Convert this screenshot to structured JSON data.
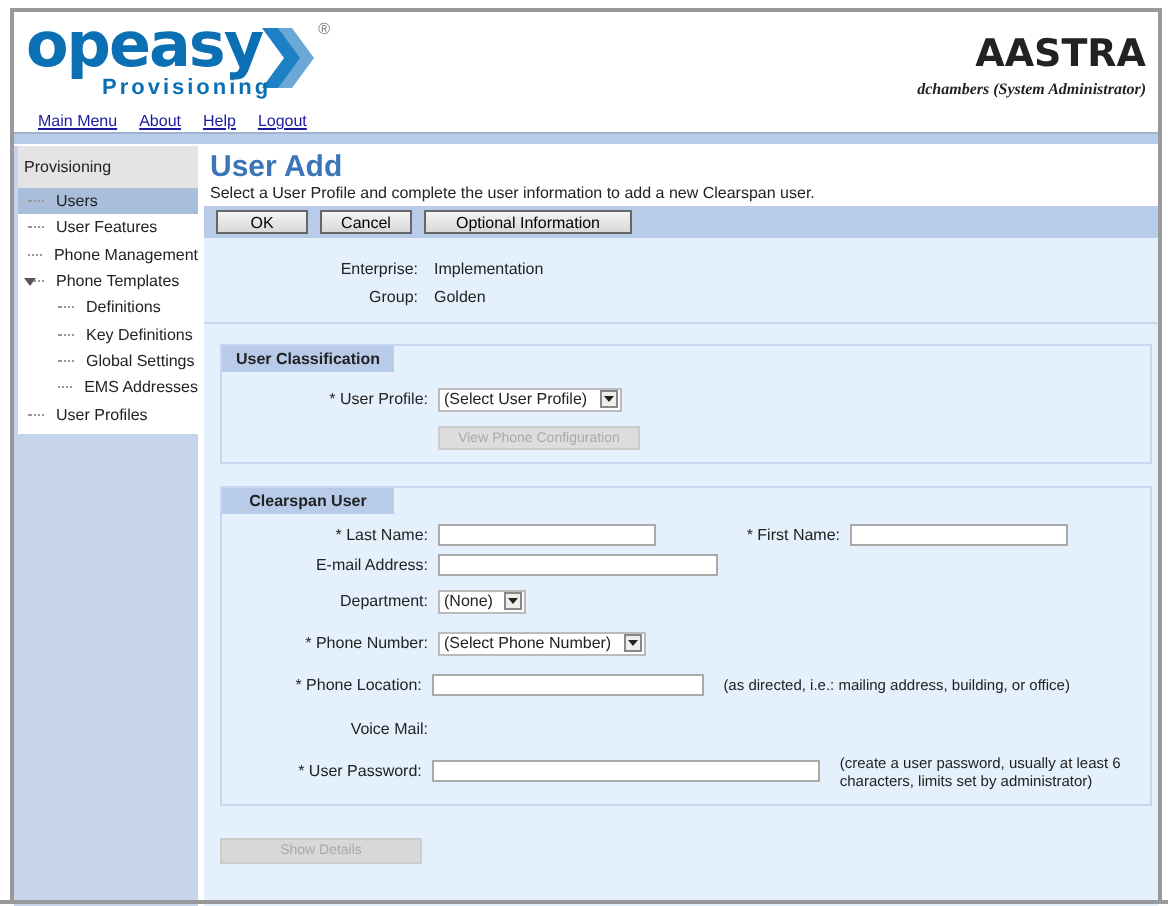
{
  "logo": {
    "name": "opeasy",
    "subtitle": "Provisioning",
    "mark": "®"
  },
  "brand": "AASTRA",
  "user": "dchambers (System Administrator)",
  "nav": [
    "Main Menu",
    "About",
    "Help",
    "Logout"
  ],
  "sidebar": {
    "title": "Provisioning",
    "items": [
      {
        "label": "Users",
        "selected": true
      },
      {
        "label": "User Features",
        "selected": false
      },
      {
        "label": "Phone Management",
        "selected": false
      },
      {
        "label": "Phone Templates",
        "selected": false,
        "expanded": true,
        "children": [
          {
            "label": "Definitions",
            "selected": false
          },
          {
            "label": "Key Definitions",
            "selected": false
          },
          {
            "label": "Global Settings",
            "selected": false
          },
          {
            "label": "EMS Addresses",
            "selected": false
          }
        ]
      },
      {
        "label": "User Profiles",
        "selected": false
      }
    ]
  },
  "page": {
    "title": "User Add",
    "instructions": "Select a User Profile and complete the user information to add a new Clearspan user."
  },
  "toolbar": [
    "OK",
    "Cancel",
    "Optional Information"
  ],
  "info": [
    {
      "label": "Enterprise:",
      "value": "Implementation"
    },
    {
      "label": "Group:",
      "value": "Golden"
    }
  ],
  "sections": [
    {
      "title": "User Classification",
      "rows": [
        {
          "kind": "select",
          "label": "* User Profile:",
          "value": "(Select User Profile)"
        },
        {
          "kind": "button",
          "label": "View Phone Configuration",
          "disabled": true
        }
      ]
    },
    {
      "title": "Clearspan User",
      "rows": [
        {
          "kind": "pair",
          "label": "* Last Name:",
          "label2": "* First Name:"
        },
        {
          "kind": "text",
          "label": "E-mail Address:"
        },
        {
          "kind": "select",
          "label": "Department:",
          "value": "(None)"
        },
        {
          "kind": "select",
          "label": "* Phone Number:",
          "value": "(Select Phone Number)"
        },
        {
          "kind": "text",
          "label": "* Phone Location:",
          "hint": "(as directed, i.e.: mailing address, building, or office)"
        },
        {
          "kind": "static",
          "label": "Voice Mail:"
        },
        {
          "kind": "password",
          "label": "* User Password:",
          "hint": "(create a user password, usually at least 6 characters, limits set by administrator)"
        }
      ]
    }
  ],
  "footer_button": {
    "label": "Show Details",
    "disabled": true
  }
}
